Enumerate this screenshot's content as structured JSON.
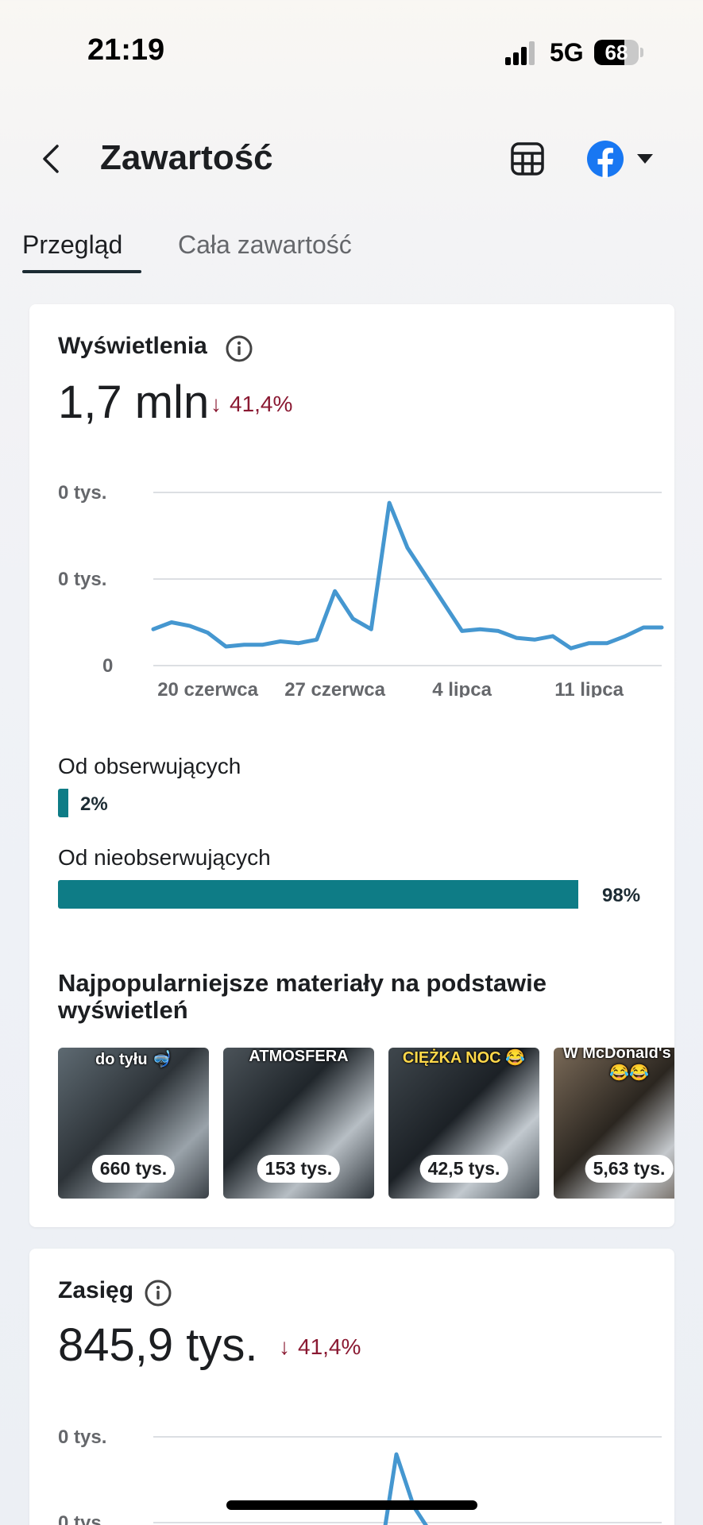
{
  "status_bar": {
    "time": "21:19",
    "network": "5G",
    "battery": "68",
    "battery_level": 0.68
  },
  "header": {
    "title": "Zawartość",
    "back_icon": "chevron-left-icon",
    "table_icon": "table-icon",
    "account_icon": "facebook-icon",
    "dropdown_icon": "caret-down-icon"
  },
  "tabs": [
    {
      "label": "Przegląd",
      "active": true
    },
    {
      "label": "Cała zawartość",
      "active": false
    }
  ],
  "views": {
    "label": "Wyświetlenia",
    "value": "1,7 mln",
    "delta": "41,4%",
    "delta_direction": "down",
    "chart": {
      "y_ticks": [
        "0 tys.",
        "0 tys.",
        "0"
      ],
      "x_labels": [
        "20 czerwca",
        "27 czerwca",
        "4 lipca",
        "11 lipca"
      ]
    },
    "followers_label": "Od obserwujących",
    "followers_pct": "2%",
    "followers_share": 0.02,
    "non_followers_label": "Od nieobserwujących",
    "non_followers_pct": "98%",
    "non_followers_share": 0.98,
    "popular_title": "Najpopularniejsze materiały na podstawie wyświetleń",
    "popular": [
      {
        "caption": "do tyłu 🤿",
        "count": "660 tys."
      },
      {
        "caption": "ATMOSFERA",
        "count": "153 tys."
      },
      {
        "caption": "CIĘŻKA NOC 😂",
        "count": "42,5 tys."
      },
      {
        "caption": "W McDonald's 😂😂😂",
        "count": "5,63 tys."
      }
    ]
  },
  "reach": {
    "label": "Zasięg",
    "value": "845,9 tys.",
    "delta": "41,4%",
    "delta_direction": "down",
    "chart": {
      "y_ticks": [
        "0 tys.",
        "0 tys."
      ]
    }
  },
  "colors": {
    "accent": "#0e7c86",
    "line": "#4597d0",
    "negative": "#8a1932",
    "facebook": "#1877f2"
  },
  "chart_data": [
    {
      "type": "line",
      "title": "Wyświetlenia",
      "x_tick_labels": [
        "20 czerwca",
        "27 czerwca",
        "4 lipca",
        "11 lipca"
      ],
      "x": [
        "2024-06-17",
        "2024-06-18",
        "2024-06-19",
        "2024-06-20",
        "2024-06-21",
        "2024-06-22",
        "2024-06-23",
        "2024-06-24",
        "2024-06-25",
        "2024-06-26",
        "2024-06-27",
        "2024-06-28",
        "2024-06-29",
        "2024-06-30",
        "2024-07-01",
        "2024-07-02",
        "2024-07-03",
        "2024-07-04",
        "2024-07-05",
        "2024-07-06",
        "2024-07-07",
        "2024-07-08",
        "2024-07-09",
        "2024-07-10",
        "2024-07-11",
        "2024-07-12",
        "2024-07-13",
        "2024-07-14",
        "2024-07-15"
      ],
      "values": [
        21,
        25,
        23,
        19,
        11,
        12,
        12,
        14,
        13,
        15,
        43,
        27,
        21,
        94,
        68,
        52,
        36,
        20,
        21,
        20,
        16,
        15,
        17,
        10,
        13,
        13,
        17,
        22,
        22
      ],
      "y_tick_labels": [
        "0",
        "0 tys.",
        "0 tys."
      ],
      "y_range": [
        0,
        100
      ],
      "grid": true
    }
  ]
}
